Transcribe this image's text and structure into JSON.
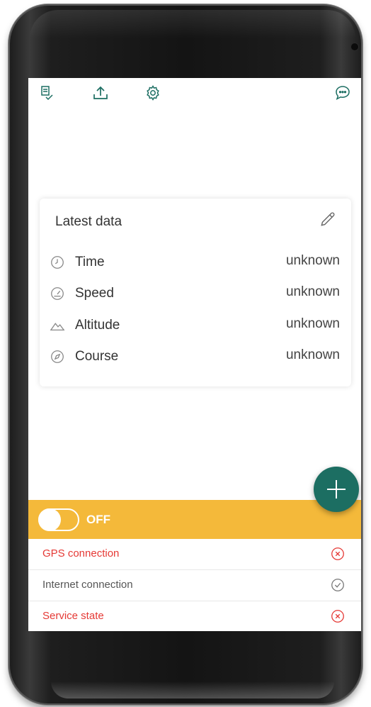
{
  "toolbar": {
    "icons": [
      "bill-check-icon",
      "upload-icon",
      "settings-gear-icon",
      "chat-bubble-icon"
    ]
  },
  "card": {
    "title": "Latest data",
    "rows": [
      {
        "icon": "clock-icon",
        "label": "Time",
        "value": "unknown"
      },
      {
        "icon": "speedometer-icon",
        "label": "Speed",
        "value": "unknown"
      },
      {
        "icon": "mountain-icon",
        "label": "Altitude",
        "value": "unknown"
      },
      {
        "icon": "compass-icon",
        "label": "Course",
        "value": "unknown"
      }
    ]
  },
  "switch": {
    "label": "OFF",
    "state": "off"
  },
  "status": [
    {
      "label": "GPS connection",
      "state": "error"
    },
    {
      "label": "Internet connection",
      "state": "ok"
    },
    {
      "label": "Service state",
      "state": "error"
    }
  ],
  "colors": {
    "accent": "#1c6e62",
    "bar": "#f4b93a",
    "error": "#e53935",
    "ok_text": "#555555"
  }
}
